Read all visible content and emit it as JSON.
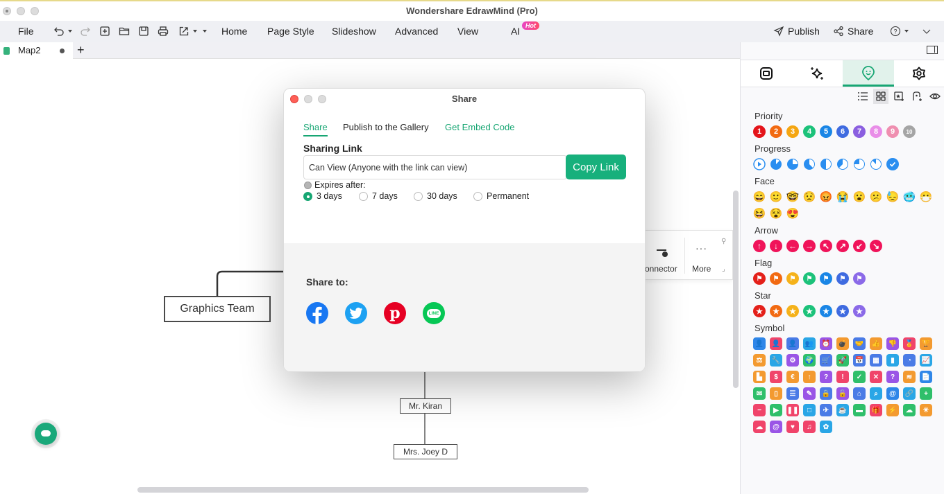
{
  "app": {
    "title": "Wondershare EdrawMind (Pro)"
  },
  "menubar": {
    "file": "File",
    "items": [
      "Home",
      "Page Style",
      "Slideshow",
      "Advanced",
      "View",
      "AI"
    ],
    "ai_badge": "Hot",
    "publish": "Publish",
    "share": "Share",
    "toolbar_icons": [
      "undo-icon",
      "redo-icon",
      "new-icon",
      "open-folder-icon",
      "save-icon",
      "print-icon",
      "export-icon",
      "more-icon"
    ]
  },
  "tabs": {
    "document": "Map2",
    "unsaved": true,
    "add_label": "+"
  },
  "canvas": {
    "nodes": {
      "graphics_team": "Graphics Team",
      "mr_kiran": "Mr. Kiran",
      "mrs_joey": "Mrs. Joey D"
    },
    "float_toolbar": {
      "connector": "onnector",
      "more": "More"
    }
  },
  "dialog": {
    "title": "Share",
    "tabs": [
      "Share",
      "Publish to the Gallery",
      "Get Embed Code"
    ],
    "active_tab": "Share",
    "sharing_link_heading": "Sharing Link",
    "permission_value": "Can View (Anyone with the link can view)",
    "copy_button": "Copy Link",
    "expires_label": "Expires after:",
    "expiry_options": [
      "3 days",
      "7 days",
      "30 days",
      "Permanent"
    ],
    "expiry_selected": "3 days",
    "share_to_label": "Share to:",
    "social": [
      "Facebook",
      "Twitter",
      "Pinterest",
      "LINE"
    ]
  },
  "panel": {
    "tabs": [
      "layout-icon",
      "ai-sparkle-icon",
      "mark-icon",
      "theme-icon"
    ],
    "active_tab": "mark-icon",
    "sections": {
      "priority": {
        "title": "Priority",
        "items": [
          "1",
          "2",
          "3",
          "4",
          "5",
          "6",
          "7",
          "8",
          "9",
          "10"
        ]
      },
      "progress": {
        "title": "Progress",
        "items": [
          "0%",
          "12.5%",
          "25%",
          "37.5%",
          "50%",
          "62.5%",
          "75%",
          "87.5%",
          "100%"
        ]
      },
      "face": {
        "title": "Face",
        "count": 14
      },
      "arrow": {
        "title": "Arrow",
        "items": [
          "up",
          "down",
          "left",
          "right",
          "up-left",
          "up-right",
          "down-left",
          "down-right"
        ]
      },
      "flag": {
        "title": "Flag",
        "count": 7
      },
      "star": {
        "title": "Star",
        "count": 7
      },
      "symbol": {
        "title": "Symbol",
        "count": 60
      }
    }
  },
  "colors": {
    "accent": "#17a673",
    "priority": [
      "#e4141a",
      "#f26a12",
      "#f5a611",
      "#1cc27a",
      "#1a86e6",
      "#3f6be0",
      "#8b5fe0",
      "#e98ee8",
      "#ef8fb0",
      "#a5a5a5"
    ],
    "progress": "#2a8ef0",
    "arrow": "#f0145a",
    "flag": [
      "#e4201a",
      "#f26a12",
      "#f5b21a",
      "#1cc27a",
      "#1a86e6",
      "#3f6be0",
      "#8b6ae8"
    ],
    "face": "#f6a94a",
    "facebook": "#1877f2",
    "twitter": "#1da1f2",
    "pinterest": "#e60023",
    "line": "#06c755"
  }
}
